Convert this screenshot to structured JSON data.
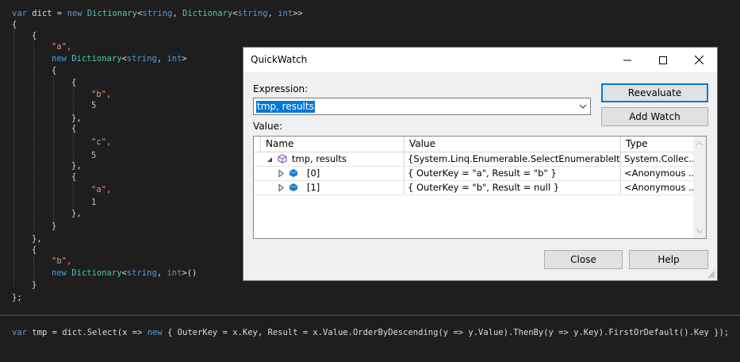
{
  "code": {
    "line1": [
      "var ",
      "dict",
      " = ",
      "new ",
      "Dictionary",
      "<",
      "string",
      ", ",
      "Dictionary",
      "<",
      "string",
      ", ",
      "int",
      ">>"
    ],
    "open_brace": "{",
    "inner_open": "{",
    "key_a": "\"a\",",
    "dict_line_1": [
      "new ",
      "Dictionary",
      "<",
      "string",
      ", ",
      "int",
      ">"
    ],
    "brace_open": "{",
    "brace_close_comma": "},",
    "brace_close": "}",
    "key_b": "\"b\",",
    "val_5": "5",
    "key_c": "\"c\",",
    "key_a2": "\"a\",",
    "val_1": "1",
    "key_b2": "\"b\",",
    "dict_line_2": [
      "new ",
      "Dictionary",
      "<",
      "string",
      ", ",
      "int",
      ">()"
    ],
    "end": "};"
  },
  "bottom_code": [
    "var ",
    "tmp",
    " = ",
    "dict",
    ".Select(",
    "x",
    " => ",
    "new ",
    "{ OuterKey = ",
    "x",
    ".Key, Result = ",
    "x",
    ".Value.OrderByDescending(",
    "y",
    " => ",
    "y",
    ".Value).ThenBy(",
    "y",
    " => ",
    "y",
    ".Key).FirstOrDefault().Key });"
  ],
  "dialog": {
    "title": "QuickWatch",
    "expression_label": "Expression:",
    "expression_value": "tmp, results",
    "value_label": "Value:",
    "reevaluate": "Reevaluate",
    "add_watch": "Add Watch",
    "close": "Close",
    "help": "Help",
    "columns": {
      "name": "Name",
      "value": "Value",
      "type": "Type"
    },
    "rows": [
      {
        "name": "tmp, results",
        "value": "{System.Linq.Enumerable.SelectEnumerableIterat...",
        "type": "System.Collec..."
      },
      {
        "name": "[0]",
        "value": "{ OuterKey = \"a\", Result = \"b\" }",
        "type": "<Anonymous ..."
      },
      {
        "name": "[1]",
        "value": "{ OuterKey = \"b\", Result = null }",
        "type": "<Anonymous ..."
      }
    ]
  },
  "colors": {
    "keyword": "#569cd6",
    "type": "#4ec9b0",
    "string": "#d69d85",
    "number": "#b5cea8",
    "selection": "#0078d7"
  }
}
